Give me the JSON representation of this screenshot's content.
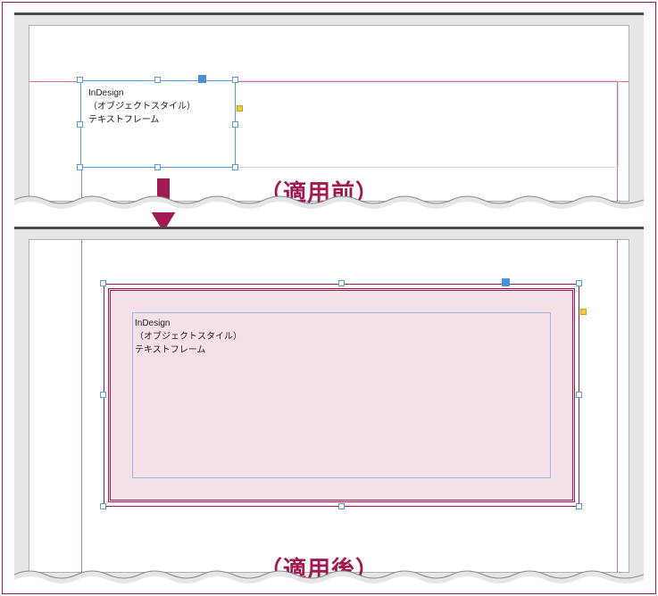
{
  "captions": {
    "before": "（適用前）",
    "after": "（適用後）"
  },
  "textframe": {
    "line1": "InDesign",
    "line2": "（オブジェクトスタイル）",
    "line3": "テキストフレーム"
  },
  "colors": {
    "accent": "#a01950",
    "guide_magenta": "#d46fa6",
    "selection_blue": "#5a9cd6",
    "handle_yellow": "#f0d040",
    "fill_pink": "#f5e0e8"
  }
}
